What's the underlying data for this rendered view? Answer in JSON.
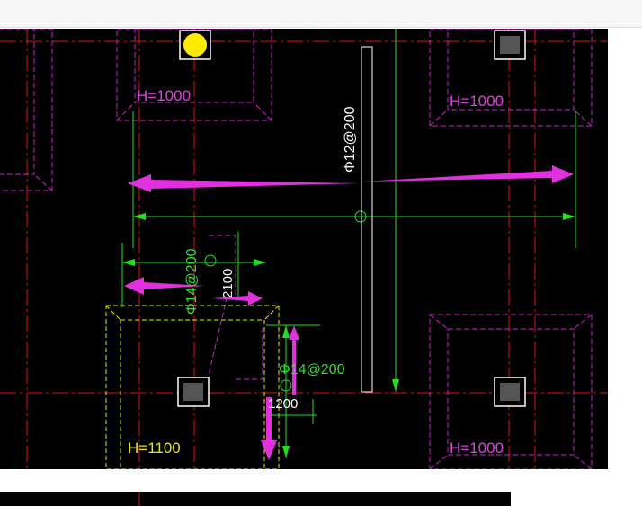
{
  "header": {
    "clipped_text": ""
  },
  "labels": {
    "h1": "H=1000",
    "h2": "H=1000",
    "h3": "H=1100",
    "h4": "H=1000",
    "rebar_top": "Φ12@200",
    "rebar_left": "Φ14@200",
    "rebar_mid": "Φ14@200",
    "dim_2100": "2100",
    "dim_1200": "1200"
  },
  "colors": {
    "background": "#000000",
    "pit_outline": "#d020d0",
    "pit_outline_yellow": "#e8e800",
    "axis": "#e01010",
    "dimension": "#20e020",
    "arrow": "#e030e0",
    "text_magenta": "#e040e0",
    "text_green": "#30e030",
    "text_yellow": "#e8e800",
    "marker": "#ffeb00"
  }
}
